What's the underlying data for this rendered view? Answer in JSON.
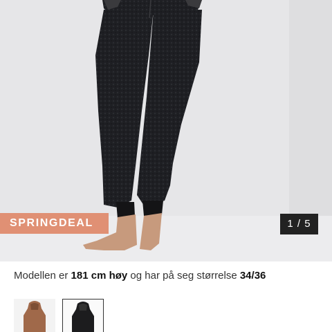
{
  "gallery": {
    "badge": "SPRINGDEAL",
    "counter": "1 / 5",
    "image_alt": "black fleece onesie on model"
  },
  "model_info": {
    "prefix": "Modellen er ",
    "height": "181 cm høy",
    "middle": " og har på seg størrelse ",
    "size": "34/36"
  },
  "color_variants": [
    {
      "name": "brown",
      "color": "#a0694a",
      "selected": false
    },
    {
      "name": "black",
      "color": "#1c1c1e",
      "selected": true
    }
  ]
}
